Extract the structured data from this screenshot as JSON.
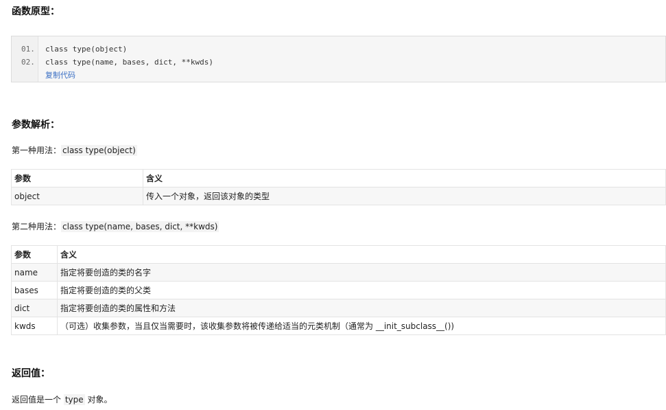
{
  "prototype": {
    "heading": "函数原型：",
    "lines": [
      {
        "num": "01.",
        "code": "class type(object)"
      },
      {
        "num": "02.",
        "code": "class type(name, bases, dict, **kwds)"
      }
    ],
    "copy_label": "复制代码"
  },
  "params": {
    "heading": "参数解析：",
    "usage1": {
      "prefix": "第一种用法：",
      "code": "class type(object)"
    },
    "table1": {
      "headers": [
        "参数",
        "含义"
      ],
      "rows": [
        [
          "object",
          "传入一个对象，返回该对象的类型"
        ]
      ]
    },
    "usage2": {
      "prefix": "第二种用法：",
      "code": "class type(name, bases, dict, **kwds)"
    },
    "table2": {
      "headers": [
        "参数",
        "含义"
      ],
      "rows": [
        [
          "name",
          "指定将要创造的类的名字"
        ],
        [
          "bases",
          "指定将要创造的类的父类"
        ],
        [
          "dict",
          "指定将要创造的类的属性和方法"
        ],
        [
          "kwds",
          "（可选）收集参数，当且仅当需要时，该收集参数将被传递给适当的元类机制（通常为 __init_subclass__())"
        ]
      ]
    }
  },
  "returns": {
    "heading": "返回值：",
    "prefix": "返回值是一个 ",
    "code": "type",
    "suffix": " 对象。"
  }
}
